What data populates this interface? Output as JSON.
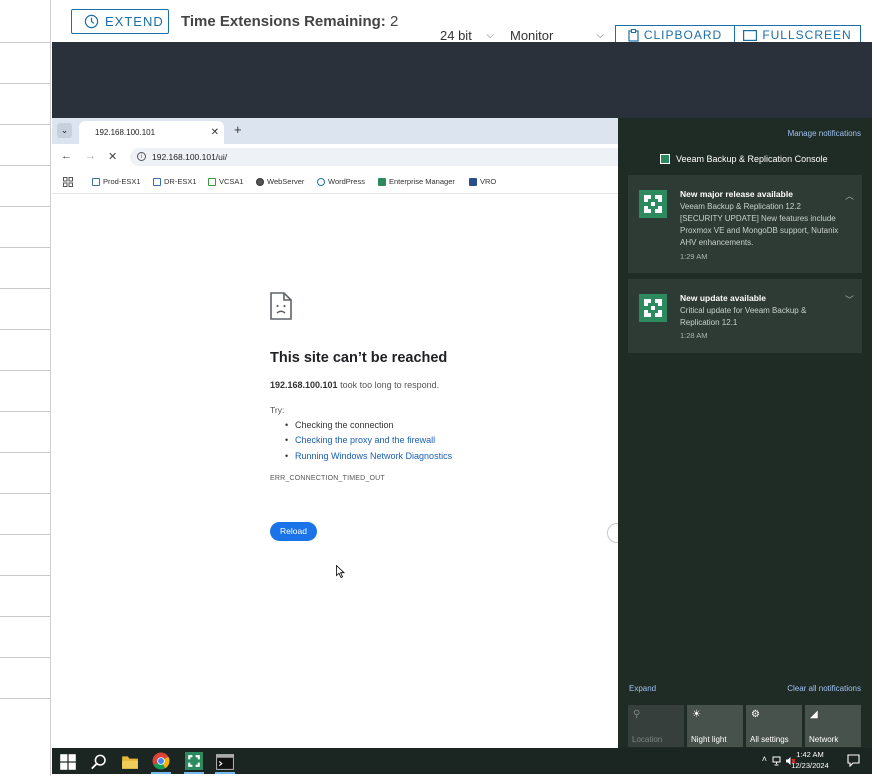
{
  "toolbar": {
    "extend_label": "EXTEND",
    "time_ext_label": "Time Extensions Remaining:",
    "time_ext_value": "2",
    "color_depth": "24 bit",
    "monitor": "Monitor",
    "clipboard_label": "CLIPBOARD",
    "fullscreen_label": "FULLSCREEN",
    "accent_color": "#1a6fa8"
  },
  "browser": {
    "tab_title": "192.168.100.101",
    "url": "192.168.100.101/ui/",
    "bookmarks": [
      {
        "label": "Prod-ESX1",
        "icon": "esx-icon"
      },
      {
        "label": "DR-ESX1",
        "icon": "esx-icon"
      },
      {
        "label": "VCSA1",
        "icon": "vcsa-icon"
      },
      {
        "label": "WebServer",
        "icon": "globe-icon"
      },
      {
        "label": "WordPress",
        "icon": "wordpress-icon"
      },
      {
        "label": "Enterprise Manager",
        "icon": "veeam-icon"
      },
      {
        "label": "VRO",
        "icon": "vro-icon"
      }
    ],
    "error": {
      "title": "This site can’t be reached",
      "host": "192.168.100.101",
      "desc": " took too long to respond.",
      "try_label": "Try:",
      "suggestions": [
        {
          "text": "Checking the connection",
          "link": false
        },
        {
          "text": "Checking the proxy and the firewall",
          "link": true
        },
        {
          "text": "Running Windows Network Diagnostics",
          "link": true
        }
      ],
      "code": "ERR_CONNECTION_TIMED_OUT",
      "reload_label": "Reload"
    }
  },
  "action_center": {
    "manage_label": "Manage notifications",
    "app_name": "Veeam Backup & Replication Console",
    "notifications": [
      {
        "title": "New major release available",
        "body": "Veeam Backup & Replication 12.2 [SECURITY UPDATE] New features include Proxmox VE and MongoDB support, Nutanix AHV enhancements.",
        "time": "1:29 AM"
      },
      {
        "title": "New update available",
        "body": "Critical update for Veeam Backup & Replication 12.1",
        "time": "1:28 AM"
      }
    ],
    "expand_label": "Expand",
    "clear_label": "Clear all notifications",
    "quick_actions": [
      {
        "label": "Location",
        "icon": "location-icon",
        "enabled": false
      },
      {
        "label": "Night light",
        "icon": "night-light-icon",
        "enabled": true
      },
      {
        "label": "All settings",
        "icon": "settings-icon",
        "enabled": true
      },
      {
        "label": "Network",
        "icon": "network-icon",
        "enabled": true
      }
    ]
  },
  "taskbar": {
    "time": "1:42 AM",
    "date": "12/23/2024"
  }
}
